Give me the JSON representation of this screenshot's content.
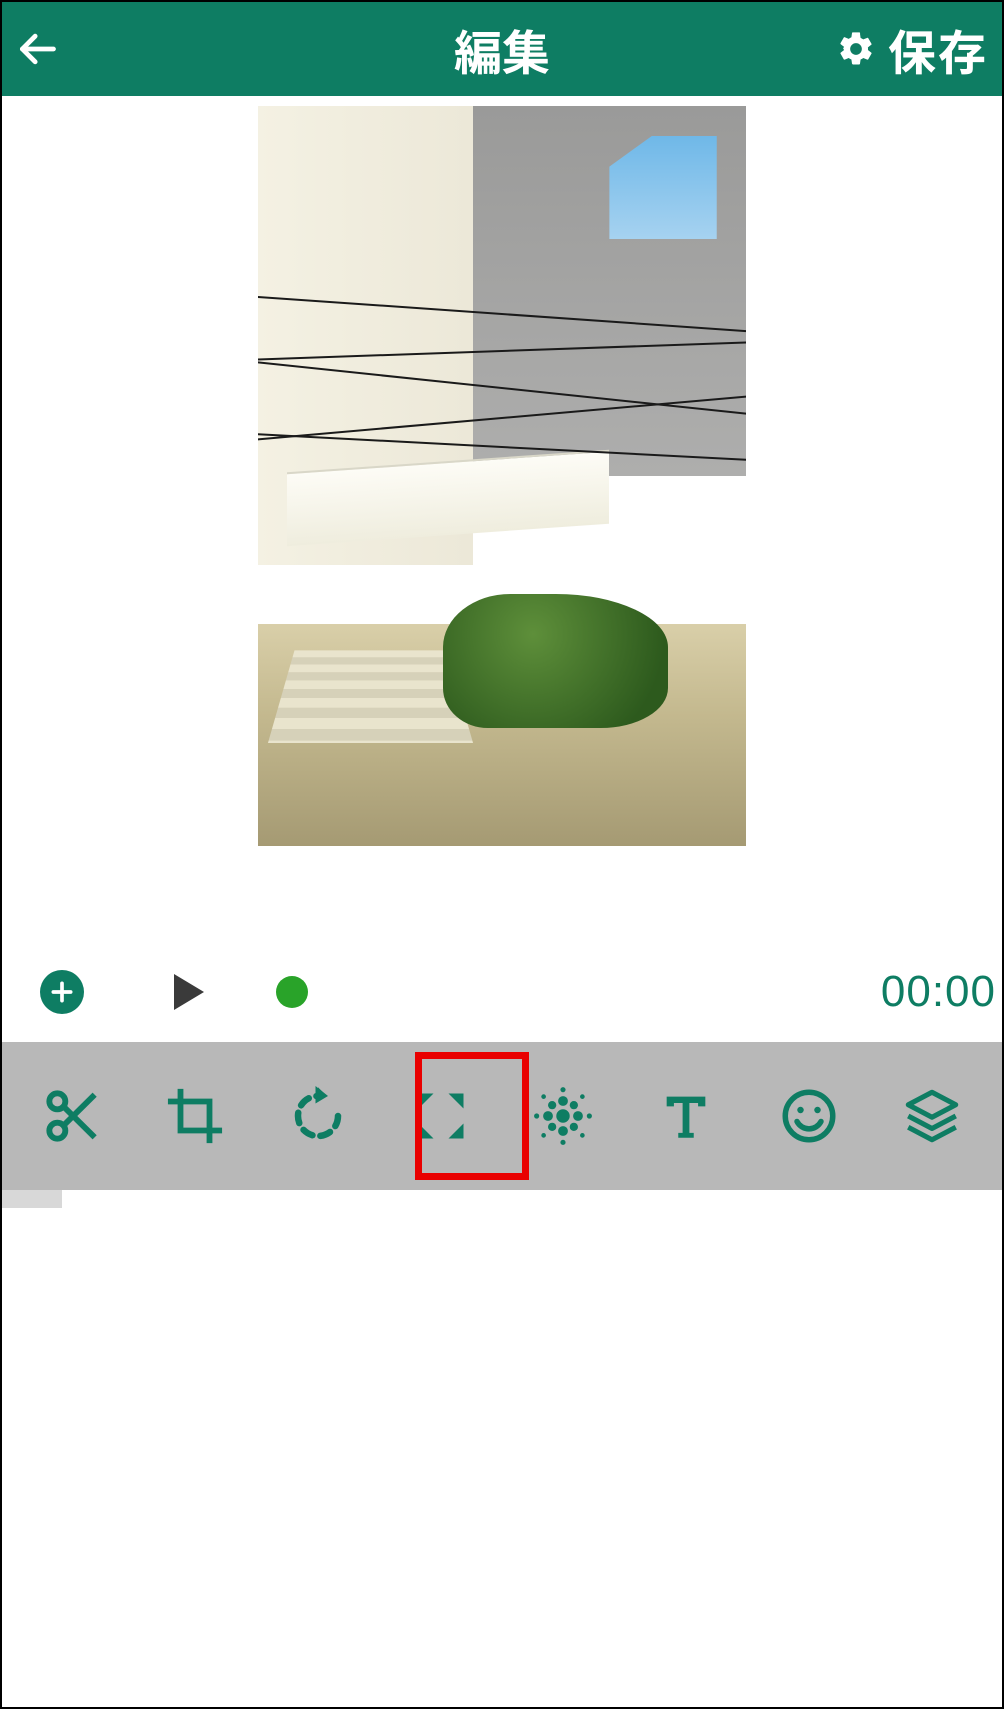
{
  "header": {
    "title": "編集",
    "save_label": "保存"
  },
  "controls": {
    "time_display": "00:00"
  },
  "toolbar": {
    "items": [
      {
        "name": "cut-icon"
      },
      {
        "name": "crop-icon"
      },
      {
        "name": "rotate-icon"
      },
      {
        "name": "expand-icon"
      },
      {
        "name": "blur-icon"
      },
      {
        "name": "text-icon"
      },
      {
        "name": "emoji-icon"
      },
      {
        "name": "layers-icon"
      }
    ]
  },
  "colors": {
    "brand": "#0e7d63",
    "accent_highlight": "#e90000",
    "play_dot": "#29a329"
  }
}
